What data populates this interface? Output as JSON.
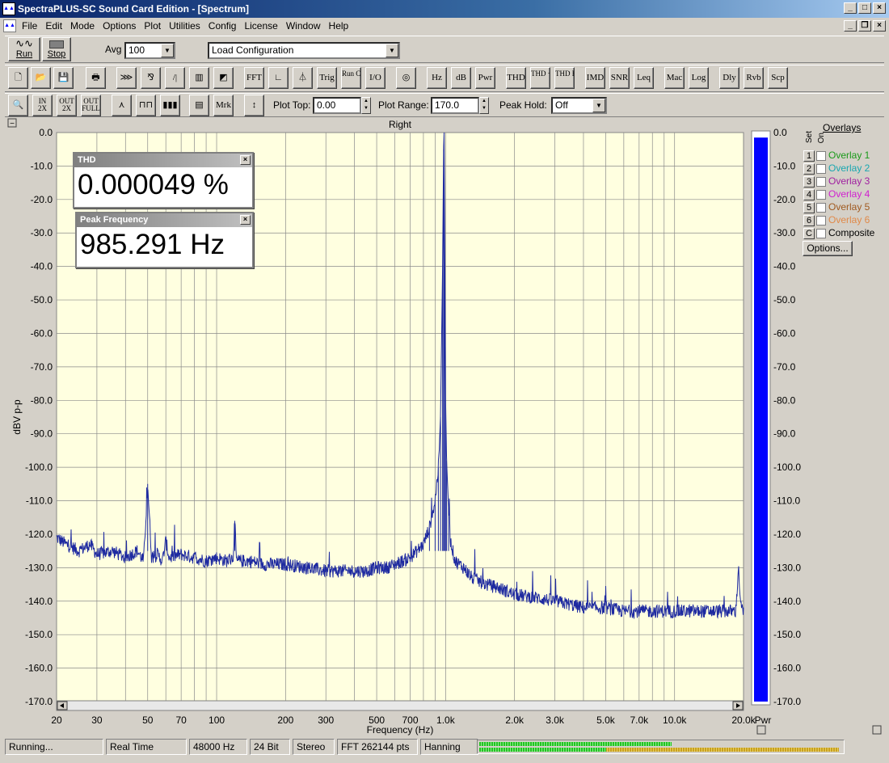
{
  "window": {
    "title": "SpectraPLUS-SC Sound Card Edition - [Spectrum]",
    "app_icon": "spectrum-icon"
  },
  "menu": [
    "File",
    "Edit",
    "Mode",
    "Options",
    "Plot",
    "Utilities",
    "Config",
    "License",
    "Window",
    "Help"
  ],
  "toolbar1": {
    "run": "Run",
    "stop": "Stop",
    "avg_label": "Avg",
    "avg_value": "100",
    "config_value": "Load Configuration"
  },
  "toolbar2": [
    "FFT",
    "Trig",
    "Run Ctrl",
    "I/O",
    "Hz",
    "dB",
    "Pwr",
    "THD",
    "THD +N",
    "THD Freq",
    "IMD",
    "SNR",
    "Leq",
    "Mac",
    "Log",
    "Dly",
    "Rvb",
    "Scp"
  ],
  "toolbar3": {
    "mrk": "Mrk",
    "plot_top_label": "Plot Top:",
    "plot_top": "0.00",
    "plot_range_label": "Plot Range:",
    "plot_range": "170.0",
    "peak_hold_label": "Peak Hold:",
    "peak_hold": "Off"
  },
  "popups": {
    "thd_title": "THD",
    "thd_value": "0.000049 %",
    "peak_title": "Peak Frequency",
    "peak_value": "985.291 Hz"
  },
  "overlays": {
    "title": "Overlays",
    "set_label": "Set",
    "on_label": "On",
    "items": [
      {
        "set": "1",
        "label": "Overlay 1",
        "color": "#1a9a1a"
      },
      {
        "set": "2",
        "label": "Overlay 2",
        "color": "#1aa7b0"
      },
      {
        "set": "3",
        "label": "Overlay 3",
        "color": "#a020a0"
      },
      {
        "set": "4",
        "label": "Overlay 4",
        "color": "#d020d0"
      },
      {
        "set": "5",
        "label": "Overlay 5",
        "color": "#a05a20"
      },
      {
        "set": "6",
        "label": "Overlay 6",
        "color": "#e08a4a"
      },
      {
        "set": "C",
        "label": "Composite",
        "color": "#000000"
      }
    ],
    "options": "Options..."
  },
  "status": [
    "Running...",
    "Real Time",
    "48000 Hz",
    "24 Bit",
    "Stereo",
    "FFT 262144 pts",
    "Hanning"
  ],
  "meter": {
    "top_level": 0.53,
    "bottom_level": 0.99,
    "bottom_green": 0.35
  },
  "chart_data": {
    "type": "line",
    "title": "Right",
    "xlabel": "Frequency (Hz)",
    "ylabel": "dBV p-p",
    "x_scale": "log",
    "xlim": [
      20,
      20000
    ],
    "ylim": [
      -170,
      0
    ],
    "grid": true,
    "background": "#ffffe0",
    "line_color": "#1e2aa0",
    "x_ticks": [
      20,
      30,
      50,
      70,
      100,
      200,
      300,
      500,
      700,
      1000,
      2000,
      3000,
      5000,
      7000,
      10000,
      20000
    ],
    "x_tick_labels": [
      "20",
      "30",
      "50",
      "70",
      "100",
      "200",
      "300",
      "500",
      "700",
      "1.0k",
      "2.0k",
      "3.0k",
      "5.0k",
      "7.0k",
      "10.0k",
      "20.0k"
    ],
    "y_ticks": [
      0,
      -10,
      -20,
      -30,
      -40,
      -50,
      -60,
      -70,
      -80,
      -90,
      -100,
      -110,
      -120,
      -130,
      -140,
      -150,
      -160,
      -170
    ],
    "y_tick_labels": [
      "0.0",
      "-10.0",
      "-20.0",
      "-30.0",
      "-40.0",
      "-50.0",
      "-60.0",
      "-70.0",
      "-80.0",
      "-90.0",
      "-100.0",
      "-110.0",
      "-120.0",
      "-130.0",
      "-140.0",
      "-150.0",
      "-160.0",
      "-170.0"
    ],
    "series": [
      {
        "x": [
          20,
          22,
          25,
          28,
          30,
          35,
          40,
          45,
          48,
          50,
          52,
          55,
          58,
          60,
          62,
          70,
          80,
          90,
          100,
          110,
          118,
          120,
          122,
          140,
          160,
          200,
          250,
          300,
          350,
          400,
          450,
          500,
          550,
          600,
          650,
          700,
          750,
          800,
          850,
          900,
          930,
          950,
          970,
          980,
          985,
          990,
          1000,
          1010,
          1030,
          1050,
          1100,
          1200,
          1300,
          1500,
          1700,
          2000,
          2500,
          3000,
          3500,
          4000,
          5000,
          6000,
          7000,
          8000,
          9000,
          10000,
          11000,
          12000,
          13000,
          15000,
          17000,
          18500,
          19000,
          19500,
          20000
        ],
        "y": [
          -121,
          -123,
          -125,
          -123,
          -126,
          -125,
          -127,
          -125,
          -128,
          -105,
          -127,
          -126,
          -128,
          -122,
          -127,
          -126,
          -127,
          -128,
          -127,
          -128,
          -127,
          -116,
          -128,
          -128,
          -129,
          -129,
          -130,
          -131,
          -131,
          -131,
          -131,
          -130,
          -130,
          -129,
          -128,
          -127,
          -125,
          -123,
          -118,
          -110,
          -100,
          -85,
          -40,
          -5,
          0,
          -25,
          -80,
          -98,
          -112,
          -122,
          -128,
          -130,
          -133,
          -135,
          -136,
          -138,
          -139,
          -140,
          -141,
          -142,
          -142,
          -143,
          -143,
          -143,
          -143,
          -143,
          -143,
          -143,
          -143,
          -143,
          -143,
          -143,
          -130,
          -142,
          -143
        ]
      }
    ],
    "power_bar": {
      "label": "Pwr",
      "value": -1.5,
      "color": "#0000ff"
    }
  }
}
